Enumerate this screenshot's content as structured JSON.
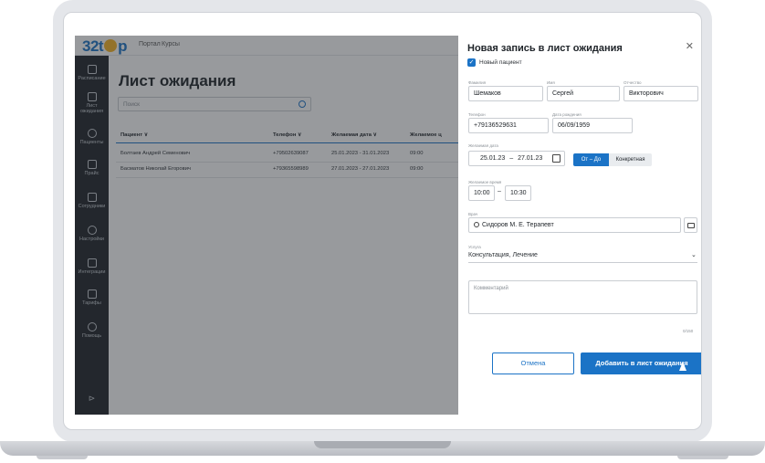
{
  "topbar": {
    "logo": "32top",
    "nav_portal": "Портал",
    "nav_courses": "Курсы"
  },
  "sidebar": {
    "items": [
      {
        "label": "Расписание",
        "icon": "calendar-icon"
      },
      {
        "label": "Лист ожидания",
        "icon": "list-edit-icon"
      },
      {
        "label": "Пациенты",
        "icon": "user-icon"
      },
      {
        "label": "Прайс",
        "icon": "ruble-icon"
      },
      {
        "label": "Сотрудники",
        "icon": "briefcase-icon"
      },
      {
        "label": "Настройки",
        "icon": "gear-icon"
      },
      {
        "label": "Интеграции",
        "icon": "integration-icon"
      },
      {
        "label": "Тарифы",
        "icon": "tariff-icon"
      },
      {
        "label": "Помощь",
        "icon": "info-icon"
      }
    ]
  },
  "main": {
    "title": "Лист ожидания",
    "search_placeholder": "Поиск",
    "columns": [
      "Пациент ∨",
      "Телефон ∨",
      "Желаемая дата ∨",
      "Желаемое ц"
    ],
    "rows": [
      [
        "Болтаев Андрей Семенович",
        "+79502639087",
        "25.01.2023 - 31.01.2023",
        "09:00"
      ],
      [
        "Басматов Николай Егорович",
        "+79365598989",
        "27.01.2023 - 27.01.2023",
        "09:00"
      ]
    ]
  },
  "dialog": {
    "title": "Новая запись в лист ожидания",
    "new_patient_label": "Новый пациент",
    "labels": {
      "last_name": "Фамилия",
      "first_name": "Имя",
      "middle_name": "Отчество",
      "phone": "Телефон",
      "birth_date": "Дата рождения",
      "desired_date": "Желаемая дата",
      "desired_time": "Желаемое время",
      "doctor": "Врач",
      "service": "Услуга"
    },
    "values": {
      "last_name": "Шемаков",
      "first_name": "Сергей",
      "middle_name": "Викторович",
      "phone": "+79136529631",
      "birth_date": "06/09/1959",
      "date_from": "25.01.23",
      "date_to": "27.01.23",
      "time_from": "10:00",
      "time_to": "10:30",
      "doctor": "Сидоров М. Е. Терапевт",
      "service": "Консультация, Лечение"
    },
    "dash": "–",
    "seg_range": "От – До",
    "seg_specific": "Конкретная",
    "comment_placeholder": "Комментарий",
    "counter": "0/150",
    "cancel": "Отмена",
    "submit": "Добавить в лист ожидания"
  },
  "colors": {
    "accent": "#1b73c6",
    "sidebar": "#1f2429"
  }
}
